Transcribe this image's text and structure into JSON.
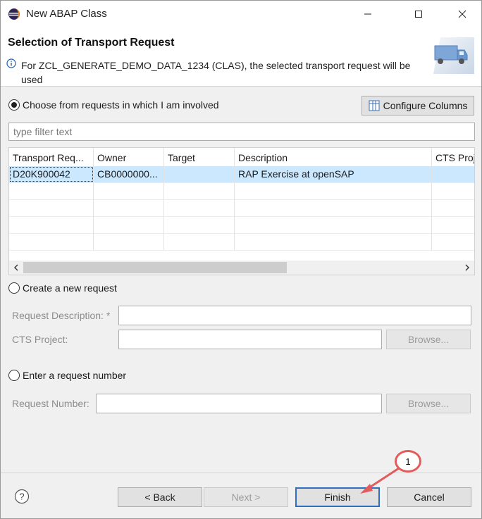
{
  "window": {
    "title": "New ABAP Class",
    "controls": {
      "minimize": "minimize",
      "maximize": "maximize",
      "close": "close"
    }
  },
  "banner": {
    "title": "Selection of Transport Request",
    "message": "For ZCL_GENERATE_DEMO_DATA_1234 (CLAS), the selected transport request will be used"
  },
  "involved": {
    "radio_label": "Choose from requests in which I am involved",
    "configure_columns_label": "Configure Columns",
    "filter_placeholder": "type filter text"
  },
  "table": {
    "columns": [
      "Transport Req...",
      "Owner",
      "Target",
      "Description",
      "CTS Proj"
    ],
    "rows": [
      {
        "transport_request": "D20K900042",
        "owner": "CB0000000...",
        "target": "",
        "description": "RAP Exercise at openSAP",
        "cts_project": ""
      }
    ]
  },
  "new_request": {
    "radio_label": "Create a new request",
    "description_label": "Request Description: *",
    "cts_project_label": "CTS Project:",
    "browse_label": "Browse..."
  },
  "request_number": {
    "radio_label": "Enter a request number",
    "field_label": "Request Number:",
    "browse_label": "Browse..."
  },
  "footer": {
    "back_label": "< Back",
    "next_label": "Next >",
    "finish_label": "Finish",
    "cancel_label": "Cancel",
    "callout_number": "1"
  },
  "colors": {
    "selection": "#cce8ff",
    "callout": "#e35c5c",
    "default_button_border": "#2f6fbe"
  }
}
